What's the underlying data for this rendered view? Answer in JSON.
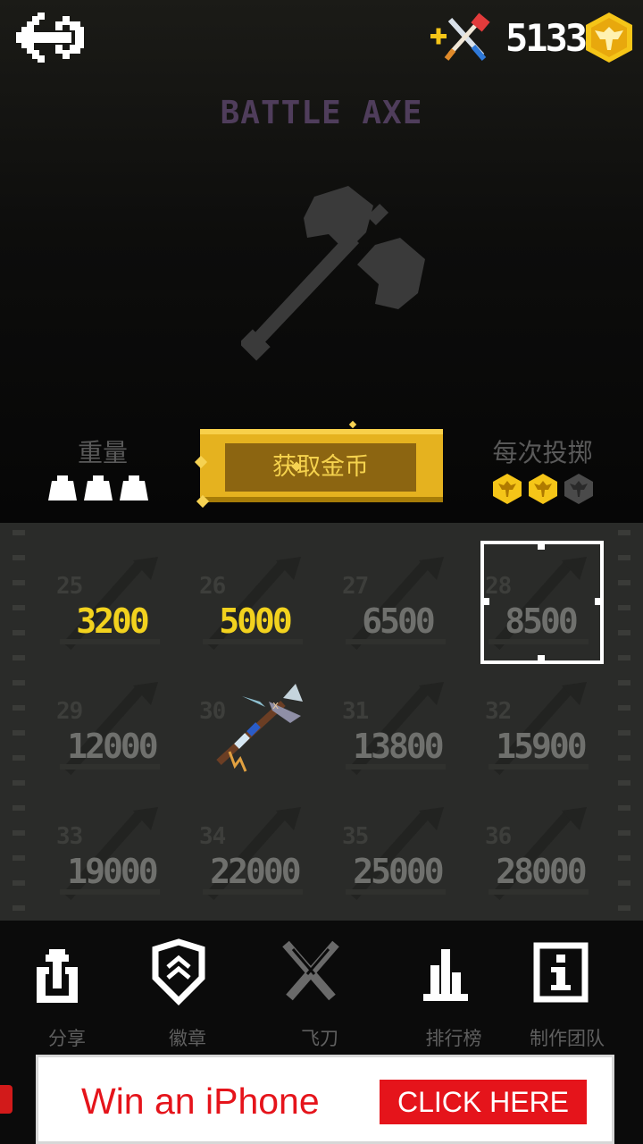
{
  "header": {
    "back_icon": "back-arrow-icon",
    "knife_shop_icon": "crossed-knife-axe-plus-icon",
    "coins": "5133",
    "coin_icon": "eagle-coin-icon"
  },
  "weapon": {
    "title": "BATTLE AXE",
    "image": "battle-axe-silhouette"
  },
  "stats": {
    "weight_label": "重量",
    "weight_level": 3,
    "weight_max": 3,
    "throw_label": "每次投掷",
    "throw_reward": 2,
    "throw_reward_max": 3
  },
  "get_coins_label": "获取金币",
  "grid": {
    "items": [
      {
        "num": "25",
        "price": "3200",
        "affordable": true,
        "unlocked": false
      },
      {
        "num": "26",
        "price": "5000",
        "affordable": true,
        "unlocked": false
      },
      {
        "num": "27",
        "price": "6500",
        "affordable": false,
        "unlocked": false
      },
      {
        "num": "28",
        "price": "8500",
        "affordable": false,
        "unlocked": false,
        "selected": true
      },
      {
        "num": "29",
        "price": "12000",
        "affordable": false,
        "unlocked": false
      },
      {
        "num": "30",
        "price": "",
        "affordable": false,
        "unlocked": true
      },
      {
        "num": "31",
        "price": "13800",
        "affordable": false,
        "unlocked": false
      },
      {
        "num": "32",
        "price": "15900",
        "affordable": false,
        "unlocked": false
      },
      {
        "num": "33",
        "price": "19000",
        "affordable": false,
        "unlocked": false
      },
      {
        "num": "34",
        "price": "22000",
        "affordable": false,
        "unlocked": false
      },
      {
        "num": "35",
        "price": "25000",
        "affordable": false,
        "unlocked": false
      },
      {
        "num": "36",
        "price": "28000",
        "affordable": false,
        "unlocked": false
      }
    ]
  },
  "nav": {
    "share": "分享",
    "badges": "徽章",
    "knives": "飞刀",
    "leaderboard": "排行榜",
    "credits": "制作团队"
  },
  "ad": {
    "text": "Win an iPhone",
    "button": "CLICK HERE"
  },
  "colors": {
    "gold": "#f2d21e",
    "coin": "#f5c518",
    "title_purple": "#4f3d5b",
    "panel": "#2a2b29",
    "ad_red": "#e5141b"
  }
}
